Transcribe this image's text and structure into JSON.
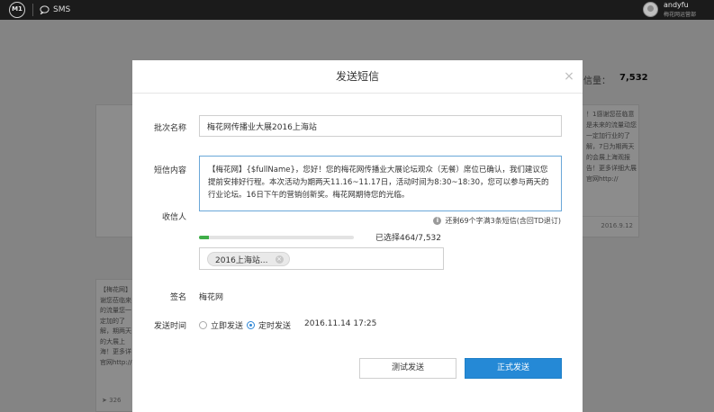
{
  "topbar": {
    "logo_text": "M1",
    "nav_sms": "SMS",
    "user_name": "andyfu",
    "user_org": "梅花网运营部"
  },
  "background": {
    "stat_label": "信量：",
    "stat_value": "7,532",
    "card_right_text": "！1感谢您莅临意是未来的流量动您一定加行业的了解，7日为期两天的会展上海观报告！更多详细大展官网http://",
    "card_right_date": "2016.9.12",
    "card_left_text": "【梅花网】谢您莅临来的流量您一定加的了解，期两天的大展上海！更多详官网http://",
    "card_left_views": "326"
  },
  "modal": {
    "title": "发送短信",
    "close_icon": "close-icon",
    "batch_label": "批次名称",
    "batch_value": "梅花网传播业大展2016上海站",
    "sms_label": "短信内容",
    "sms_content": "【梅花网】{$fullName}，您好！您的梅花网传播业大展论坛观众（无餐）席位已确认，我们建议您提前安排好行程。本次活动为期两天11.16~11.17日，活动时间为8:30~18:30，您可以参与两天的行业论坛。16日下午的营销创新奖。梅花网期待您的光临。",
    "sms_hint": "还剩69个字满3条短信(含回TD退订)",
    "receiver_label": "收信人",
    "progress_fraction": 0.062,
    "selected_count": "已选择464/7,532",
    "receiver_tag": "2016上海站...",
    "sign_label": "签名",
    "sign_value": "梅花网",
    "time_label": "发送时间",
    "radio_now": "立即发送",
    "radio_scheduled": "定时发送",
    "scheduled_selected": true,
    "send_time": "2016.11.14 17:25",
    "btn_test": "测试发送",
    "btn_send": "正式发送"
  },
  "colors": {
    "primary": "#2589d6",
    "progress": "#3fae49",
    "topbar": "#1b1b1b"
  }
}
